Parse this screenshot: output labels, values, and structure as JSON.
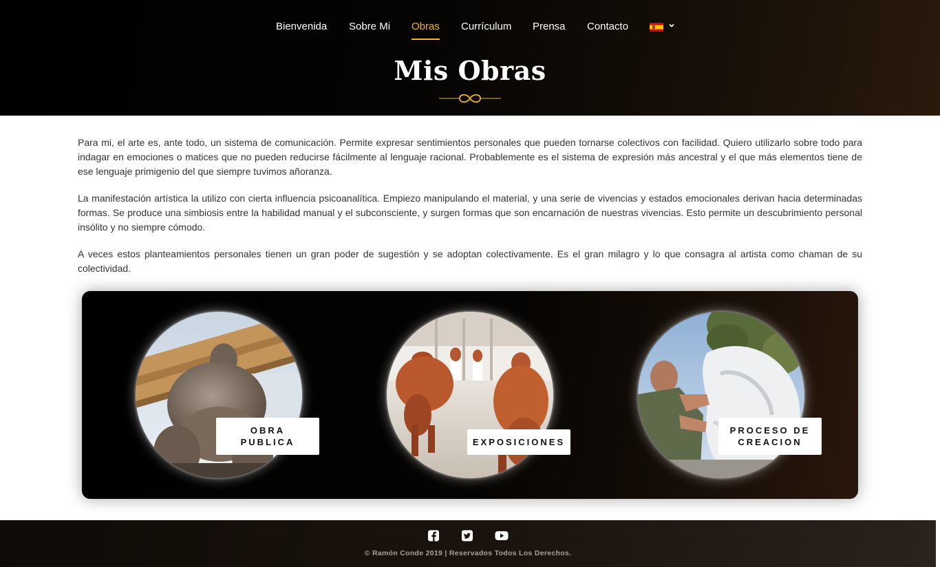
{
  "nav": {
    "items": [
      {
        "label": "Bienvenida",
        "active": false
      },
      {
        "label": "Sobre Mi",
        "active": false
      },
      {
        "label": "Obras",
        "active": true
      },
      {
        "label": "Currículum",
        "active": false
      },
      {
        "label": "Prensa",
        "active": false
      },
      {
        "label": "Contacto",
        "active": false
      }
    ],
    "language_icon": "spain-flag-icon",
    "language_dropdown_icon": "chevron-down-icon"
  },
  "header": {
    "title": "Mis Obras",
    "divider_icon": "infinity-ornament-icon"
  },
  "intro": {
    "paragraphs": [
      "Para mi, el arte es, ante todo, un sistema de comunicación. Permite expresar sentimientos personales que pueden tornarse colectivos con facilidad. Quiero utilizarlo sobre todo para indagar en emociones o matices que no pueden reducirse fácilmente al lenguaje racional. Probablemente es el sistema de expresión más ancestral y el que más elementos tiene de ese lenguaje primigenio del que siempre tuvimos añoranza.",
      "La manifestación artística la utilizo con cierta influencia psicoanalítica. Empiezo manipulando el material, y una serie de vivencias y estados emocionales derivan hacia determinadas formas. Se produce una simbiosis entre la habilidad manual y el subconsciente, y surgen formas que son encarnación de nuestras vivencias. Esto permite un descubrimiento personal insólito y no siempre cómodo.",
      "A veces estos planteamientos personales tienen un gran poder de sugestión y se adoptan colectivamente. Es el gran milagro y lo que consagra al artista como chaman de su colectividad."
    ]
  },
  "works": [
    {
      "line1": "OBRA",
      "line2": "PUBLICA"
    },
    {
      "line1": "EXPOSICIONES",
      "line2": ""
    },
    {
      "line1": "PROCESO DE",
      "line2": "CREACION"
    }
  ],
  "footer": {
    "social": [
      "facebook-icon",
      "twitter-icon",
      "youtube-icon"
    ],
    "copyright": "© Ramón Conde 2019 | Reservados Todos Los Derechos."
  },
  "colors": {
    "accent": "#f0b428",
    "text": "#333333",
    "nav_text": "#ffffff"
  }
}
